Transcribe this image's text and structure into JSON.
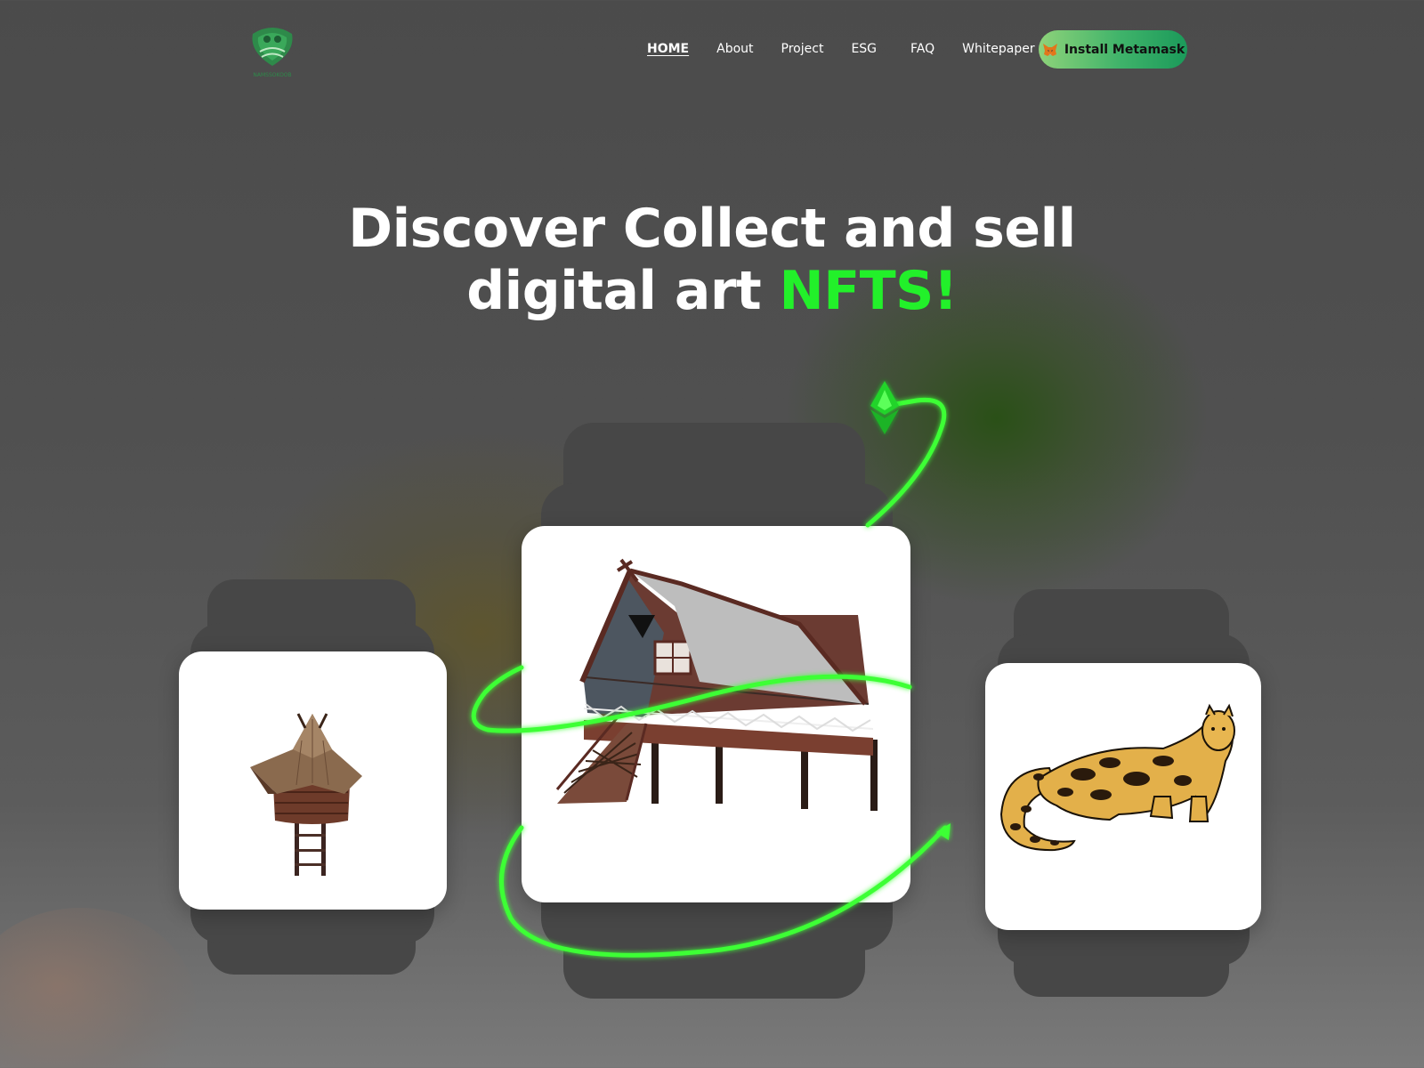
{
  "header": {
    "logo_label": "NAMSSOKOOB",
    "nav": [
      {
        "label": "HOME",
        "active": true
      },
      {
        "label": "About",
        "active": false
      },
      {
        "label": "Project",
        "active": false
      },
      {
        "label": "ESG",
        "active": false
      },
      {
        "label": "FAQ",
        "active": false
      },
      {
        "label": "Whitepaper",
        "active": false
      }
    ],
    "cta_label": "Install Metamask",
    "cta_icon": "metamask-fox-icon"
  },
  "hero": {
    "line1": "Discover Collect and sell",
    "line2_prefix": "digital art ",
    "line2_accent": "NFTS!"
  },
  "cards": [
    {
      "name": "stilt-hut",
      "subject": "stilt-hut-image"
    },
    {
      "name": "stilt-house",
      "subject": "stilt-house-image"
    },
    {
      "name": "clouded-leopard",
      "subject": "clouded-leopard-image"
    }
  ],
  "colors": {
    "accent_green": "#22f02a",
    "cta_gradient_start": "#8ed37a",
    "cta_gradient_end": "#1b9a5a",
    "card_back": "#474747"
  }
}
